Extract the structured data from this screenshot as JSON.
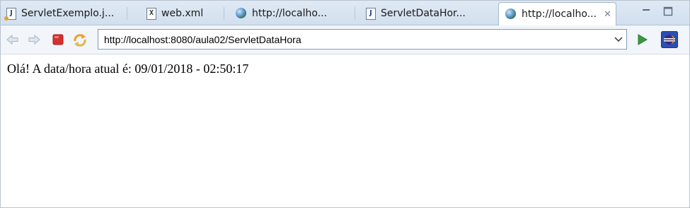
{
  "tabs": [
    {
      "label": "ServletExemplo.j...",
      "icon": "java-file-run-icon"
    },
    {
      "label": "web.xml",
      "icon": "xml-file-icon"
    },
    {
      "label": "http://localho...",
      "icon": "globe-icon"
    },
    {
      "label": "ServletDataHor...",
      "icon": "java-file-icon"
    },
    {
      "label": "http://localho...",
      "icon": "globe-icon",
      "active": true,
      "close": "✕"
    }
  ],
  "window": {
    "minimize": "minimize-icon",
    "maximize": "maximize-icon"
  },
  "toolbar": {
    "back": "back-arrow-icon",
    "forward": "forward-arrow-icon",
    "stop": "stop-icon",
    "refresh": "refresh-icon",
    "go": "go-icon",
    "eclipse": "eclipse-icon"
  },
  "address": {
    "url": "http://localhost:8080/aula02/ServletDataHora"
  },
  "page": {
    "text": "Olá! A data/hora atual é: 09/01/2018 - 02:50:17"
  },
  "colors": {
    "accent": "#3a9a3a",
    "stop": "#d9302c",
    "tabbar": "#d8e4f1"
  }
}
